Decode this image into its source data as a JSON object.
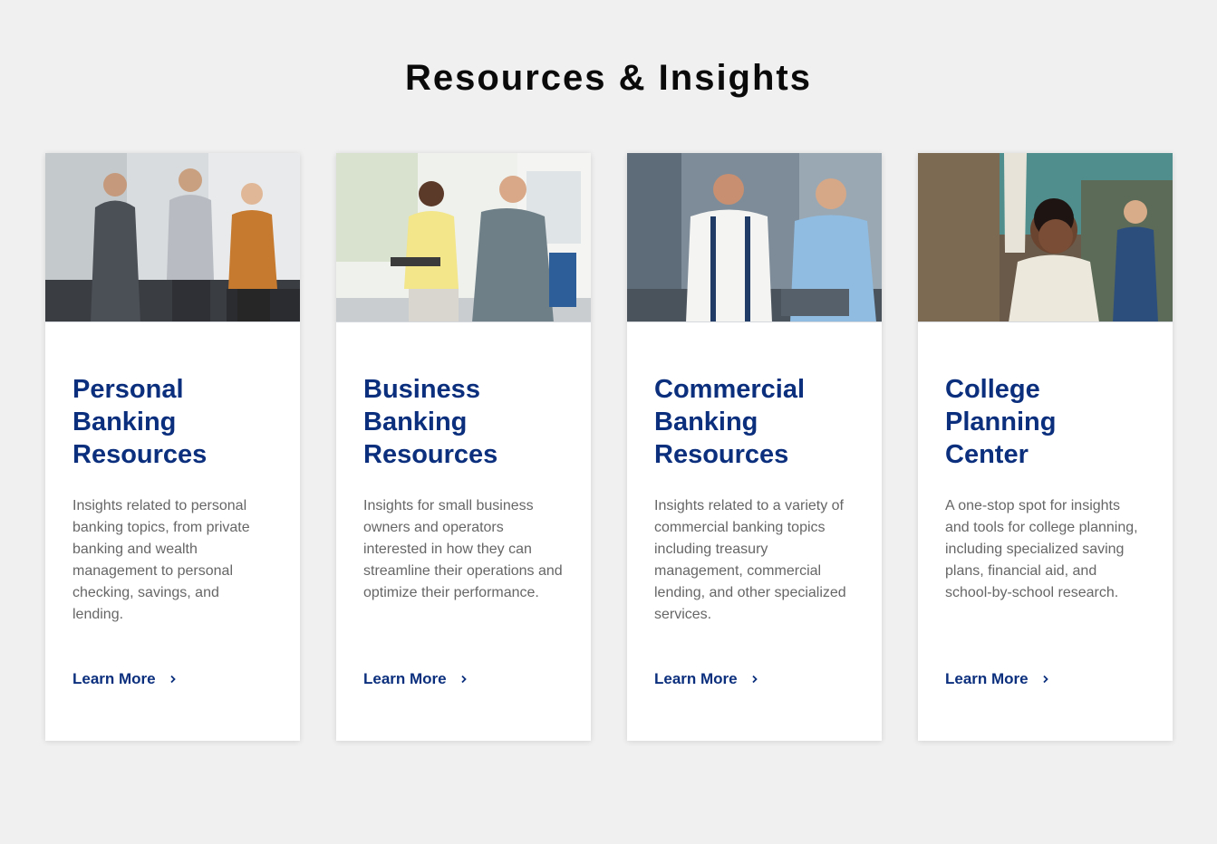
{
  "section": {
    "title": "Resources & Insights"
  },
  "cards": [
    {
      "title": "Personal Banking Resources",
      "description": "Insights related to personal banking topics, from private banking and wealth management to personal checking, savings, and lending.",
      "link_label": "Learn More",
      "link_icon": "chevron-right-icon",
      "image": "photo-three-people-handshake-office"
    },
    {
      "title": "Business Banking Resources",
      "description": "Insights for small business owners and operators interested in how they can streamline their operations and optimize their performance.",
      "link_label": "Learn More",
      "link_icon": "chevron-right-icon",
      "image": "photo-two-people-meeting-office"
    },
    {
      "title": "Commercial Banking Resources",
      "description": "Insights related to a variety of commercial banking topics including treasury management, commercial lending, and other specialized services.",
      "link_label": "Learn More",
      "link_icon": "chevron-right-icon",
      "image": "photo-two-men-with-tablet-workshop"
    },
    {
      "title": "College Planning Center",
      "description": "A one-stop spot for insights and tools for college planning, including specialized saving plans, financial aid, and school-by-school research.",
      "link_label": "Learn More",
      "link_icon": "chevron-right-icon",
      "image": "photo-student-raising-hand-classroom"
    }
  ],
  "colors": {
    "page_background": "#f0f0f0",
    "card_background": "#ffffff",
    "heading_blue": "#0b2f7d",
    "body_text": "#666666",
    "section_title": "#0a0a0a"
  }
}
